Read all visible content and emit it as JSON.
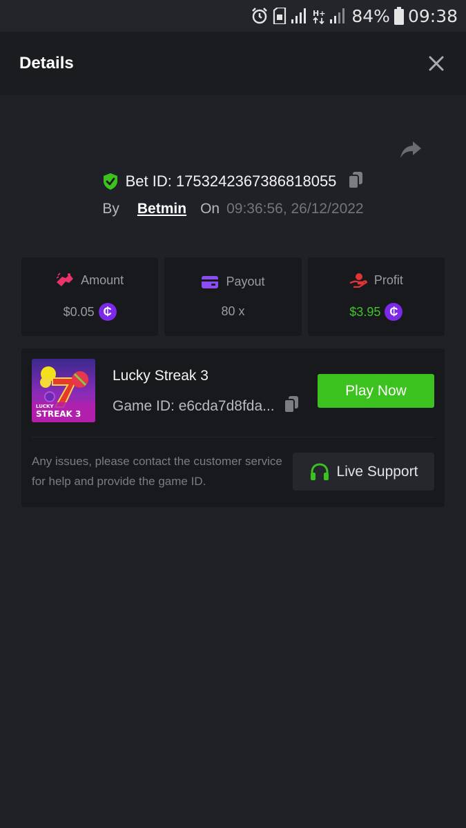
{
  "status_bar": {
    "battery_percent": "84%",
    "time": "09:38",
    "icons": [
      "alarm-icon",
      "sim-icon",
      "signal-icon",
      "hplus-icon",
      "signal-icon",
      "battery-icon"
    ]
  },
  "header": {
    "title": "Details",
    "close_icon": "close-icon"
  },
  "bet": {
    "id_label": "Bet ID: 1753242367386818055",
    "by_label": "By",
    "user": "Betmin",
    "on_label": "On",
    "datetime": "09:36:56, 26/12/2022"
  },
  "stats": [
    {
      "label": "Amount",
      "value": "$0.05",
      "icon": "amount-icon",
      "color": "#e8336b"
    },
    {
      "label": "Payout",
      "value": "80 x",
      "icon": "wallet-icon",
      "color": "#8b4cf2"
    },
    {
      "label": "Profit",
      "value": "$3.95",
      "icon": "profit-icon",
      "color": "#e23434"
    }
  ],
  "game": {
    "name": "Lucky Streak 3",
    "id_label": "Game ID: e6cda7d8fda...",
    "thumb_title_line1": "LUCKY",
    "thumb_title_line2": "STREAK 3",
    "play_label": "Play Now",
    "help_text": "Any issues, please contact the customer service for help and provide the game ID.",
    "support_label": "Live Support"
  },
  "colors": {
    "accent_green": "#3bc21f",
    "coin_purple": "#7c2ae8",
    "background": "#202126",
    "card": "#18191d"
  }
}
